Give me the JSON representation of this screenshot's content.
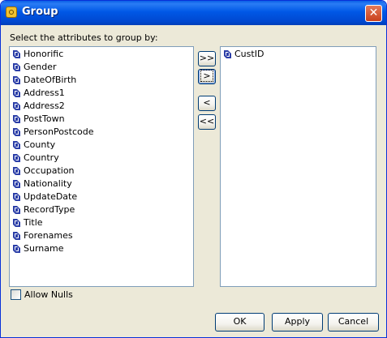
{
  "window": {
    "title": "Group",
    "close_glyph": "✕"
  },
  "prompt": "Select the attributes to group by:",
  "available": [
    "Honorific",
    "Gender",
    "DateOfBirth",
    "Address1",
    "Address2",
    "PostTown",
    "PersonPostcode",
    "County",
    "Country",
    "Occupation",
    "Nationality",
    "UpdateDate",
    "RecordType",
    "Title",
    "Forenames",
    "Surname"
  ],
  "selected": [
    "CustID"
  ],
  "move_buttons": {
    "add_all": ">>",
    "add": ">",
    "remove": "<",
    "remove_all": "<<"
  },
  "allow_nulls": {
    "label": "Allow Nulls",
    "checked": false
  },
  "footer": {
    "ok": "OK",
    "apply": "Apply",
    "cancel": "Cancel"
  },
  "icons": {
    "attribute": "attribute-icon",
    "app": "group-app-icon",
    "close": "close-icon"
  },
  "colors": {
    "dialog_bg": "#ece9d8",
    "titlebar": "#0054e3",
    "close": "#c9401c",
    "icon_blue": "#2c3fa8"
  }
}
